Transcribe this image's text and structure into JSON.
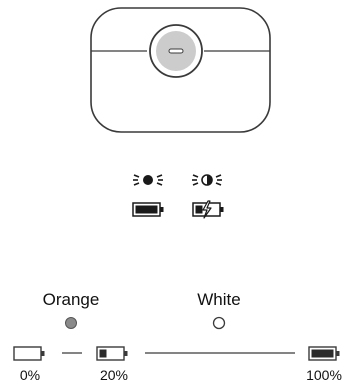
{
  "colors": {
    "stroke": "#3a3a3a",
    "case_fill": "#ffffff",
    "button_fill": "#cccccc",
    "orange_dot": "#8a8a8a",
    "white_dot": "#ffffff",
    "battery_fill": "#2b2b2b"
  },
  "icons": {
    "solid_light": "light-on-icon",
    "pulsing_light": "light-pulsing-icon",
    "battery_full": "battery-full-icon",
    "battery_charging": "battery-charging-icon",
    "battery_empty": "battery-empty-icon",
    "battery_low": "battery-low-icon",
    "battery_high": "battery-full-icon"
  },
  "scale": {
    "orange_label": "Orange",
    "white_label": "White",
    "levels": {
      "empty": {
        "label": "0%",
        "fill": 0
      },
      "low": {
        "label": "20%",
        "fill": 0.2
      },
      "full": {
        "label": "100%",
        "fill": 1
      }
    }
  }
}
